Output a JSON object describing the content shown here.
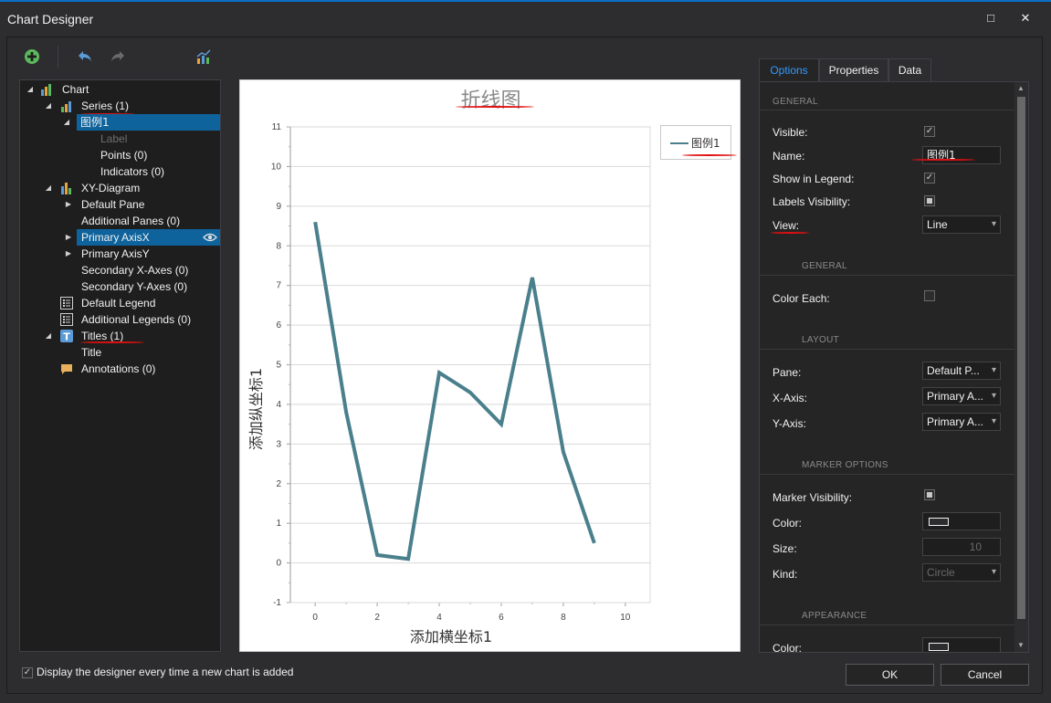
{
  "window": {
    "title": "Chart Designer",
    "maximize_glyph": "□",
    "close_glyph": "✕"
  },
  "toolbar": {
    "add_icon": "add-icon",
    "undo_icon": "undo-icon",
    "redo_icon": "redo-icon",
    "chart_wizard_icon": "chart-icon"
  },
  "tree": {
    "chart": "Chart",
    "series": "Series (1)",
    "series_item": "图例1",
    "label": "Label",
    "points": "Points (0)",
    "indicators": "Indicators (0)",
    "diagram": "XY-Diagram",
    "default_pane": "Default Pane",
    "additional_panes": "Additional Panes (0)",
    "primary_axis_x": "Primary AxisX",
    "primary_axis_y": "Primary AxisY",
    "secondary_x": "Secondary X-Axes (0)",
    "secondary_y": "Secondary Y-Axes (0)",
    "default_legend": "Default Legend",
    "additional_legends": "Additional Legends (0)",
    "titles": "Titles (1)",
    "title": "Title",
    "annotations": "Annotations (0)"
  },
  "chart_data": {
    "type": "line",
    "title": "折线图",
    "xlabel": "添加横坐标1",
    "ylabel": "添加纵坐标1",
    "xlim": [
      -0.8,
      10.8
    ],
    "ylim": [
      -1,
      11
    ],
    "xticks": [
      0,
      2,
      4,
      6,
      8,
      10
    ],
    "yticks": [
      -1,
      0,
      1,
      2,
      3,
      4,
      5,
      6,
      7,
      8,
      9,
      10,
      11
    ],
    "grid": true,
    "legend_position": "top-right",
    "color": "#4a7f8c",
    "series": [
      {
        "name": "图例1",
        "x": [
          0,
          1,
          2,
          3,
          4,
          5,
          6,
          7,
          8,
          9
        ],
        "values": [
          8.6,
          3.8,
          0.2,
          0.1,
          4.8,
          4.3,
          3.5,
          7.2,
          2.8,
          0.5
        ]
      }
    ]
  },
  "tabs": {
    "options": "Options",
    "properties": "Properties",
    "data": "Data"
  },
  "props": {
    "general_head": "GENERAL",
    "visible": "Visible:",
    "name": "Name:",
    "name_value": "图例1",
    "show_in_legend": "Show in Legend:",
    "labels_visibility": "Labels Visibility:",
    "view": "View:",
    "view_value": "Line",
    "general2_head": "GENERAL",
    "color_each": "Color Each:",
    "layout_head": "LAYOUT",
    "pane": "Pane:",
    "pane_value": "Default P...",
    "x_axis": "X-Axis:",
    "x_axis_value": "Primary A...",
    "y_axis": "Y-Axis:",
    "y_axis_value": "Primary A...",
    "marker_head": "MARKER OPTIONS",
    "marker_visibility": "Marker Visibility:",
    "color": "Color:",
    "size": "Size:",
    "size_value": "10",
    "kind": "Kind:",
    "kind_value": "Circle",
    "appearance_head": "APPEARANCE",
    "appearance_color": "Color:"
  },
  "footer": {
    "show_designer": "Display the designer every time a new chart is added",
    "ok": "OK",
    "cancel": "Cancel"
  }
}
